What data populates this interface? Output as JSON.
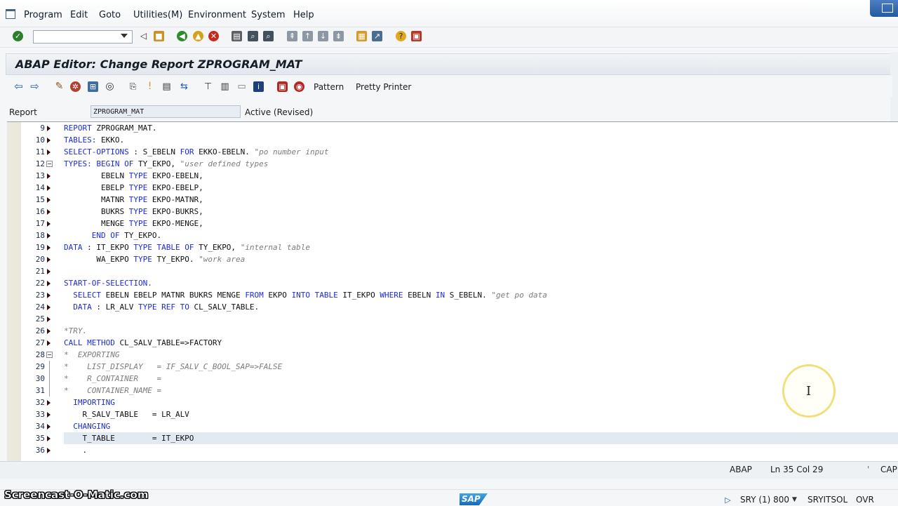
{
  "menubar": {
    "items": [
      "Program",
      "Edit",
      "Goto",
      "Utilities(M)",
      "Environment",
      "System",
      "Help"
    ]
  },
  "toolbar1": {
    "command_field_value": "",
    "icons": [
      "enter-icon",
      "back-icon",
      "save-icon",
      "back-green-icon",
      "exit-icon",
      "cancel-icon",
      "print-icon",
      "find-icon",
      "find-next-icon",
      "first-page-icon",
      "prev-page-icon",
      "next-page-icon",
      "last-page-icon",
      "create-session-icon",
      "shortcut-icon",
      "help-icon",
      "layout-icon"
    ]
  },
  "title": "ABAP Editor: Change Report ZPROGRAM_MAT",
  "toolbar2": {
    "pattern_label": "Pattern",
    "pretty_printer_label": "Pretty Printer"
  },
  "report": {
    "label": "Report",
    "value": "ZPROGRAM_MAT",
    "status": "Active (Revised)"
  },
  "code": [
    {
      "n": "9",
      "marker": "arrow",
      "parts": [
        [
          "kw",
          "REPORT"
        ],
        [
          "t",
          " ZPROGRAM_MAT."
        ]
      ]
    },
    {
      "n": "10",
      "marker": "arrow",
      "parts": [
        [
          "kw",
          "TABLES:"
        ],
        [
          "t",
          " EKKO."
        ]
      ]
    },
    {
      "n": "11",
      "marker": "arrow",
      "parts": [
        [
          "kw",
          "SELECT-OPTIONS"
        ],
        [
          "t",
          " : S_EBELN "
        ],
        [
          "kw",
          "FOR"
        ],
        [
          "t",
          " EKKO-EBELN. "
        ],
        [
          "cm",
          "\"po number input"
        ]
      ]
    },
    {
      "n": "12",
      "marker": "fold",
      "parts": [
        [
          "kw",
          "TYPES:"
        ],
        [
          "t",
          " "
        ],
        [
          "kw",
          "BEGIN OF"
        ],
        [
          "t",
          " TY_EKPO, "
        ],
        [
          "cm",
          "\"user defined types"
        ]
      ]
    },
    {
      "n": "13",
      "marker": "arrow",
      "parts": [
        [
          "t",
          "        EBELN "
        ],
        [
          "kw",
          "TYPE"
        ],
        [
          "t",
          " EKPO-EBELN,"
        ]
      ]
    },
    {
      "n": "14",
      "marker": "arrow",
      "parts": [
        [
          "t",
          "        EBELP "
        ],
        [
          "kw",
          "TYPE"
        ],
        [
          "t",
          " EKPO-EBELP,"
        ]
      ]
    },
    {
      "n": "15",
      "marker": "arrow",
      "parts": [
        [
          "t",
          "        MATNR "
        ],
        [
          "kw",
          "TYPE"
        ],
        [
          "t",
          " EKPO-MATNR,"
        ]
      ]
    },
    {
      "n": "16",
      "marker": "arrow",
      "parts": [
        [
          "t",
          "        BUKRS "
        ],
        [
          "kw",
          "TYPE"
        ],
        [
          "t",
          " EKPO-BUKRS,"
        ]
      ]
    },
    {
      "n": "17",
      "marker": "arrow",
      "parts": [
        [
          "t",
          "        MENGE "
        ],
        [
          "kw",
          "TYPE"
        ],
        [
          "t",
          " EKPO-MENGE,"
        ]
      ]
    },
    {
      "n": "18",
      "marker": "arrow",
      "parts": [
        [
          "t",
          "      "
        ],
        [
          "kw",
          "END OF"
        ],
        [
          "t",
          " TY_EKPO."
        ]
      ]
    },
    {
      "n": "19",
      "marker": "arrow",
      "parts": [
        [
          "kw",
          "DATA"
        ],
        [
          "t",
          " : IT_EKPO "
        ],
        [
          "kw",
          "TYPE TABLE OF"
        ],
        [
          "t",
          " TY_EKPO, "
        ],
        [
          "cm",
          "\"internal table"
        ]
      ]
    },
    {
      "n": "20",
      "marker": "arrow",
      "parts": [
        [
          "t",
          "       WA_EKPO "
        ],
        [
          "kw",
          "TYPE"
        ],
        [
          "t",
          " TY_EKPO. "
        ],
        [
          "cm",
          "\"work area"
        ]
      ]
    },
    {
      "n": "21",
      "marker": "arrow",
      "parts": [
        [
          "t",
          ""
        ]
      ]
    },
    {
      "n": "22",
      "marker": "arrow",
      "parts": [
        [
          "kw",
          "START-OF-SELECTION."
        ]
      ]
    },
    {
      "n": "23",
      "marker": "arrow",
      "parts": [
        [
          "t",
          "  "
        ],
        [
          "kw",
          "SELECT"
        ],
        [
          "t",
          " EBELN EBELP MATNR BUKRS MENGE "
        ],
        [
          "kw",
          "FROM"
        ],
        [
          "t",
          " EKPO "
        ],
        [
          "kw",
          "INTO TABLE"
        ],
        [
          "t",
          " IT_EKPO "
        ],
        [
          "kw",
          "WHERE"
        ],
        [
          "t",
          " EBELN "
        ],
        [
          "kw",
          "IN"
        ],
        [
          "t",
          " S_EBELN. "
        ],
        [
          "cm",
          "\"get po data"
        ]
      ]
    },
    {
      "n": "24",
      "marker": "arrow",
      "parts": [
        [
          "t",
          "  "
        ],
        [
          "kw",
          "DATA"
        ],
        [
          "t",
          " : LR_ALV "
        ],
        [
          "kw",
          "TYPE REF TO"
        ],
        [
          "t",
          " CL_SALV_TABLE."
        ]
      ]
    },
    {
      "n": "25",
      "marker": "arrow",
      "parts": [
        [
          "t",
          ""
        ]
      ]
    },
    {
      "n": "26",
      "marker": "arrow",
      "parts": [
        [
          "cm",
          "*TRY."
        ]
      ]
    },
    {
      "n": "27",
      "marker": "arrow",
      "parts": [
        [
          "kw",
          "CALL METHOD"
        ],
        [
          "t",
          " CL_SALV_TABLE=>FACTORY"
        ]
      ]
    },
    {
      "n": "28",
      "marker": "fold",
      "parts": [
        [
          "cm",
          "*  EXPORTING"
        ]
      ]
    },
    {
      "n": "29",
      "marker": "brace",
      "parts": [
        [
          "cm",
          "*    LIST_DISPLAY   = IF_SALV_C_BOOL_SAP=>FALSE"
        ]
      ]
    },
    {
      "n": "30",
      "marker": "brace",
      "parts": [
        [
          "cm",
          "*    R_CONTAINER    ="
        ]
      ]
    },
    {
      "n": "31",
      "marker": "brace",
      "parts": [
        [
          "cm",
          "*    CONTAINER_NAME ="
        ]
      ]
    },
    {
      "n": "32",
      "marker": "arrow",
      "parts": [
        [
          "t",
          "  "
        ],
        [
          "kw",
          "IMPORTING"
        ]
      ]
    },
    {
      "n": "33",
      "marker": "arrow",
      "parts": [
        [
          "t",
          "    R_SALV_TABLE   = LR_ALV"
        ]
      ]
    },
    {
      "n": "34",
      "marker": "arrow",
      "parts": [
        [
          "t",
          "  "
        ],
        [
          "kw",
          "CHANGING"
        ]
      ]
    },
    {
      "n": "35",
      "marker": "arrow",
      "highlight": true,
      "parts": [
        [
          "t",
          "    T_TABLE        = IT_EKPO"
        ]
      ]
    },
    {
      "n": "36",
      "marker": "arrow",
      "parts": [
        [
          "t",
          "    ."
        ]
      ]
    }
  ],
  "statusbar": {
    "mode": "ABAP",
    "position": "Ln  35 Col  29",
    "caps": "CAP"
  },
  "bottombar": {
    "system": "SRY (1) 800",
    "server": "SRYITSOL",
    "insert_mode": "OVR",
    "brand": "SAP",
    "watermark": "Screencast-O-Matic.com"
  }
}
